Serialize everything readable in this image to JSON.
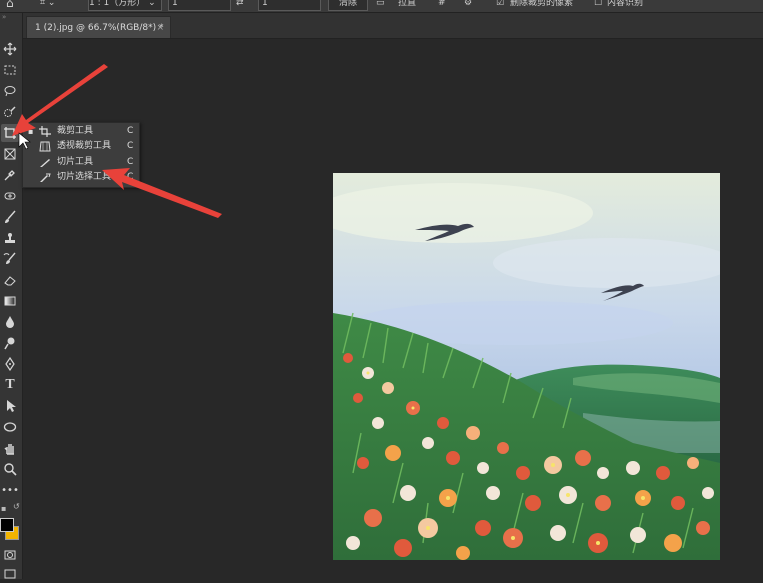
{
  "options_bar": {
    "ratio_value": "1 : 1（方形）",
    "width_value": "1",
    "height_value": "1",
    "clear_label": "清除",
    "straighten_label": "拉直",
    "delete_cropped_label": "删除裁剪的像素",
    "content_aware_label": "内容识别",
    "delete_cropped_checked": true,
    "content_aware_checked": false
  },
  "document_tab": {
    "title": "1 (2).jpg @ 66.7%(RGB/8*) *",
    "close": "×"
  },
  "crop_flyout": {
    "items": [
      {
        "label": "裁剪工具",
        "shortcut": "C",
        "icon": "crop-icon",
        "active": true
      },
      {
        "label": "透视裁剪工具",
        "shortcut": "C",
        "icon": "perspective-crop-icon",
        "active": false
      },
      {
        "label": "切片工具",
        "shortcut": "C",
        "icon": "slice-icon",
        "active": false
      },
      {
        "label": "切片选择工具",
        "shortcut": "C",
        "icon": "slice-select-icon",
        "active": false
      }
    ]
  },
  "toolbar": {
    "type_tool_glyph": "T"
  },
  "colors": {
    "foreground": "#000000",
    "background": "#f2b400",
    "annotation_arrow": "#e8423a"
  }
}
